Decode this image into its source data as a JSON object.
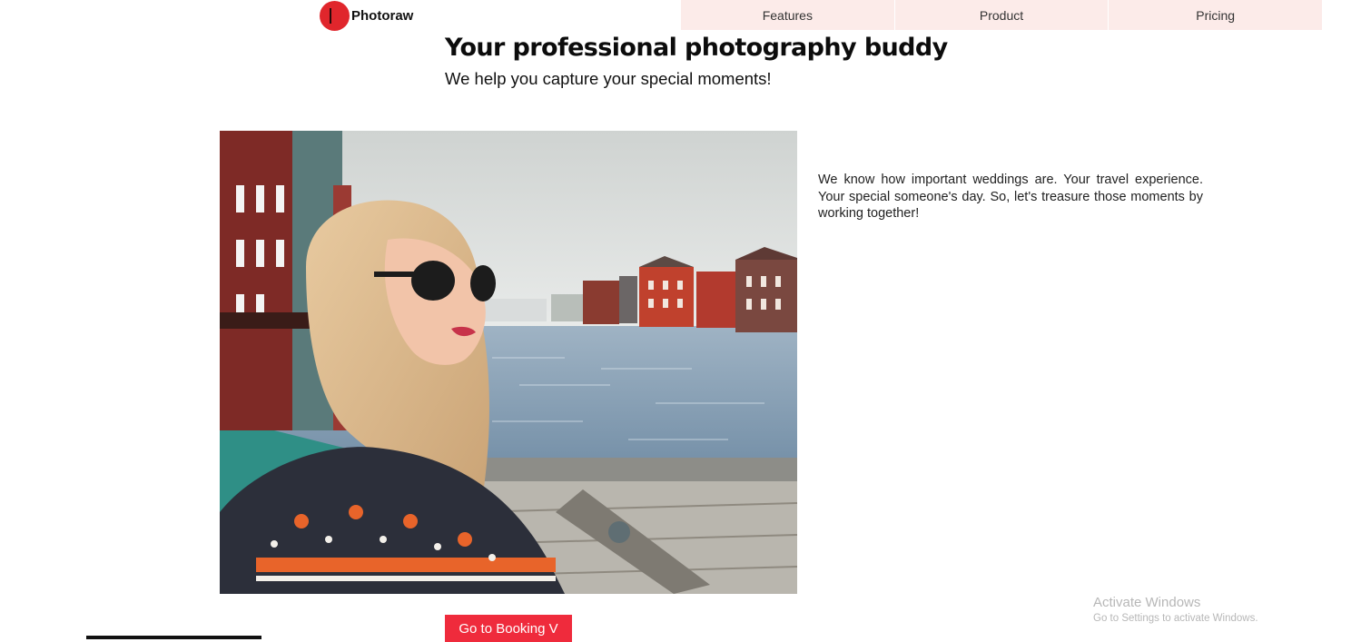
{
  "brand": {
    "name": "Photoraw",
    "logo_color": "#e0262c"
  },
  "nav": {
    "background": "#fcebe9",
    "items": [
      {
        "label": "Features"
      },
      {
        "label": "Product"
      },
      {
        "label": "Pricing"
      }
    ]
  },
  "hero": {
    "title": "Your professional photography buddy",
    "subtitle": "We help you capture your special moments!"
  },
  "content": {
    "image_description_icon": "photo-woman-sunglasses-harbor",
    "text": "We know how important weddings are. Your travel experience. Your special someone's day. So, let's treasure those moments by working together!"
  },
  "cta": {
    "label": "Go to Booking V",
    "color": "#ef2b3c"
  },
  "watermark": {
    "title": "Activate Windows",
    "subtitle": "Go to Settings to activate Windows."
  }
}
